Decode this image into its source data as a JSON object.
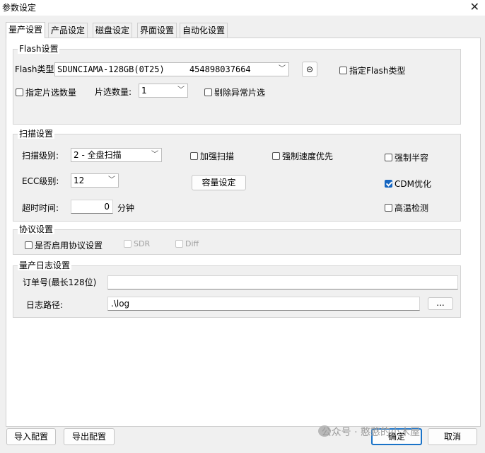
{
  "window": {
    "title": "参数设定",
    "close_icon": "close-icon"
  },
  "tabs": [
    {
      "label": "量产设置",
      "active": true
    },
    {
      "label": "产品设定",
      "active": false
    },
    {
      "label": "磁盘设定",
      "active": false
    },
    {
      "label": "界面设置",
      "active": false
    },
    {
      "label": "自动化设置",
      "active": false
    }
  ],
  "flash": {
    "group_label": "Flash设置",
    "type_label": "Flash类型:",
    "type_value": "SDUNCIAMA-128GB(0T25)",
    "type_id": "454898037664",
    "settings_button": "⊝",
    "specify_type": {
      "label": "指定Flash类型",
      "checked": false
    },
    "specify_chip_count": {
      "label": "指定片选数量",
      "checked": false
    },
    "chip_count_label": "片选数量:",
    "chip_count_value": "1",
    "exclude_abnormal": {
      "label": "剔除异常片选",
      "checked": false
    }
  },
  "scan": {
    "group_label": "扫描设置",
    "level_label": "扫描级别:",
    "level_value": "2 - 全盘扫描",
    "enhanced": {
      "label": "加强扫描",
      "checked": false
    },
    "force_speed": {
      "label": "强制速度优先",
      "checked": false
    },
    "force_half": {
      "label": "强制半容",
      "checked": false
    },
    "ecc_label": "ECC级别:",
    "ecc_value": "12",
    "capacity_button": "容量设定",
    "cdm": {
      "label": "CDM优化",
      "checked": true
    },
    "timeout_label": "超时时间:",
    "timeout_value": "0",
    "timeout_unit": "分钟",
    "high_temp": {
      "label": "高温检测",
      "checked": false
    }
  },
  "protocol": {
    "group_label": "协议设置",
    "enable": {
      "label": "是否启用协议设置",
      "checked": false
    },
    "sdr": {
      "label": "SDR",
      "checked": false
    },
    "diff": {
      "label": "Diff",
      "checked": false
    }
  },
  "log": {
    "group_label": "量产日志设置",
    "order_label": "订单号(最长128位)",
    "order_value": "",
    "path_label": "日志路径:",
    "path_value": ".\\log",
    "browse_button": "..."
  },
  "footer": {
    "import_button": "导入配置",
    "export_button": "导出配置",
    "ok_button": "确定",
    "cancel_button": "取消",
    "watermark": "公众号 · 憨憨的小木屋"
  },
  "colors": {
    "accent": "#1a73c8",
    "checked": "#1565c0"
  }
}
